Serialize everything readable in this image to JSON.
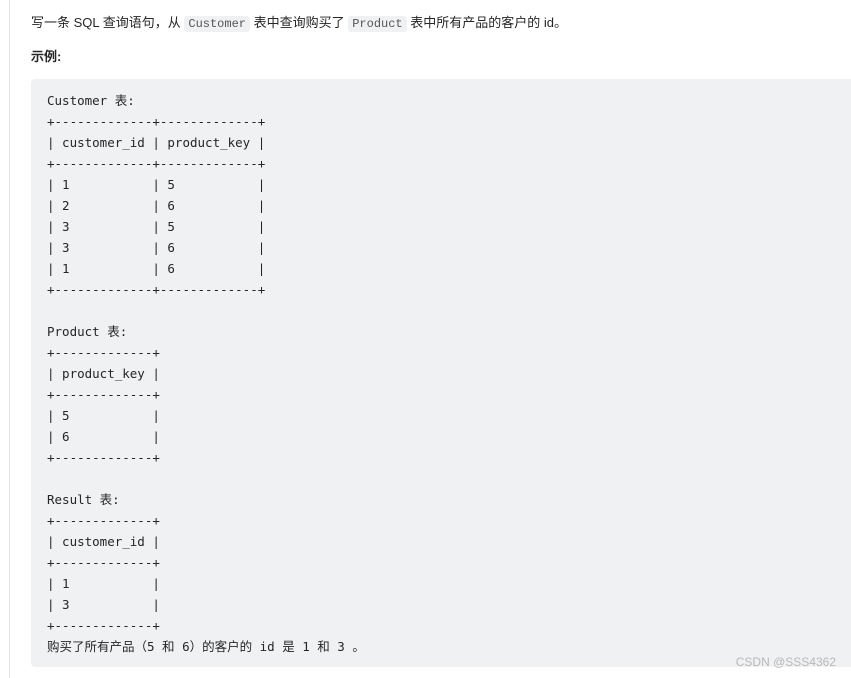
{
  "description": {
    "part1": "写一条 SQL 查询语句，从 ",
    "code1": "Customer",
    "part2": " 表中查询购买了 ",
    "code2": "Product",
    "part3": " 表中所有产品的客户的 id。"
  },
  "example_label": "示例:",
  "code_lines": [
    "Customer 表:",
    "+-------------+-------------+",
    "| customer_id | product_key |",
    "+-------------+-------------+",
    "| 1           | 5           |",
    "| 2           | 6           |",
    "| 3           | 5           |",
    "| 3           | 6           |",
    "| 1           | 6           |",
    "+-------------+-------------+",
    "",
    "Product 表:",
    "+-------------+",
    "| product_key |",
    "+-------------+",
    "| 5           |",
    "| 6           |",
    "+-------------+",
    "",
    "Result 表:",
    "+-------------+",
    "| customer_id |",
    "+-------------+",
    "| 1           |",
    "| 3           |",
    "+-------------+",
    "购买了所有产品（5 和 6）的客户的 id 是 1 和 3 。"
  ],
  "tables": {
    "customer": {
      "title": "Customer 表",
      "columns": [
        "customer_id",
        "product_key"
      ],
      "rows": [
        [
          1,
          5
        ],
        [
          2,
          6
        ],
        [
          3,
          5
        ],
        [
          3,
          6
        ],
        [
          1,
          6
        ]
      ]
    },
    "product": {
      "title": "Product 表",
      "columns": [
        "product_key"
      ],
      "rows": [
        [
          5
        ],
        [
          6
        ]
      ]
    },
    "result": {
      "title": "Result 表",
      "columns": [
        "customer_id"
      ],
      "rows": [
        [
          1
        ],
        [
          3
        ]
      ]
    }
  },
  "watermark": "CSDN @SSS4362"
}
